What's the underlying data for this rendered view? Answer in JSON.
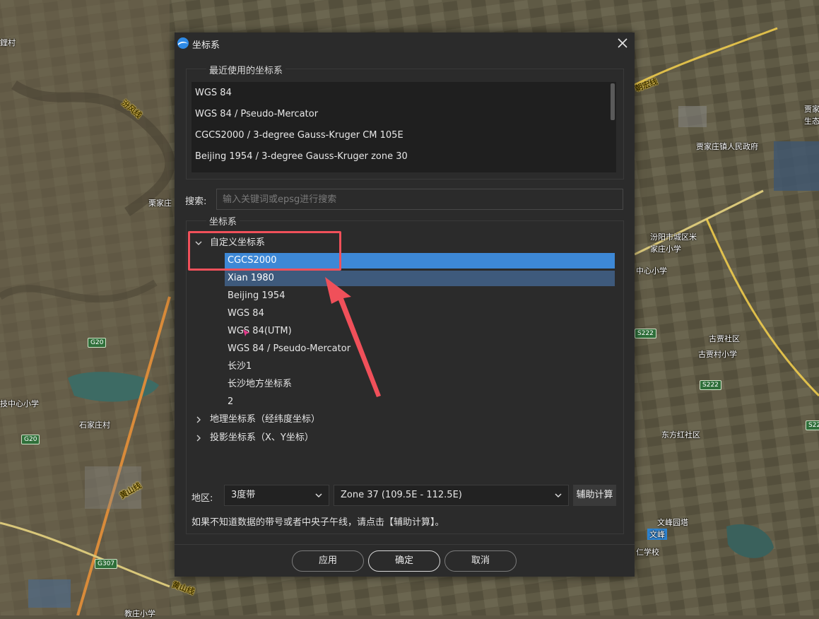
{
  "map": {
    "labels": {
      "cun_top_left": "鋰村",
      "lijiazhuang": "栗家庄",
      "jiazhuang_top_right": "贾家",
      "shengtai": "生态",
      "gov": "贾家庄镇人民政府",
      "fenyang_school_1": "汾阳市城区米",
      "fenyang_school_2": "家庄小学",
      "center_school": "中心小学",
      "gujia": "古贾社区",
      "gujia_school": "古贾村小学",
      "dongfang": "东方红社区",
      "wenfeng": "文峰",
      "wenfeng_park": "文峰园塔",
      "renxuexiao": "仁学校",
      "jizhongxin": "技中心小学",
      "shijiazhuang": "石家庄村",
      "jiaoxin": "教庄小学"
    },
    "roads": {
      "g20_a": "G20",
      "g20_b": "G20",
      "g307": "G307",
      "s222_a": "S222",
      "s222_b": "S222",
      "s222_c": "S22",
      "huangshan_a": "黄山线",
      "huangshan_b": "黄山线",
      "fengxian": "汾风线",
      "chaohong": "朝宏线"
    }
  },
  "dialog": {
    "title": "坐标系",
    "recent": {
      "title": "最近使用的坐标系",
      "items": [
        "WGS 84",
        "WGS 84 / Pseudo-Mercator",
        "CGCS2000 / 3-degree Gauss-Kruger CM 105E",
        "Beijing 1954 / 3-degree Gauss-Kruger zone 30"
      ]
    },
    "search": {
      "label": "搜索:",
      "placeholder": "输入关键词或epsg进行搜索"
    },
    "crs": {
      "title": "坐标系",
      "custom_group": "自定义坐标系",
      "custom_items": [
        "CGCS2000",
        "Xian 1980",
        "Beijing 1954",
        "WGS 84",
        "WGS 84(UTM)",
        "WGS 84 / Pseudo-Mercator",
        "长沙1",
        "长沙地方坐标系",
        "2"
      ],
      "geo_group": "地理坐标系（经纬度坐标）",
      "proj_group": "投影坐标系（X、Y坐标）"
    },
    "zone": {
      "label": "地区:",
      "band": "3度带",
      "zone": "Zone 37 (109.5E - 112.5E)",
      "calc": "辅助计算",
      "hint": "如果不知道数据的带号或者中央子午线，请点击【辅助计算】。"
    },
    "buttons": {
      "apply": "应用",
      "ok": "确定",
      "cancel": "取消"
    }
  },
  "colors": {
    "selection_primary": "#3d88d6",
    "selection_secondary": "#3e5a7c",
    "annotation_red": "#f0505a"
  },
  "icons": [
    "app-logo-icon",
    "close-icon",
    "chevron-down-icon",
    "chevron-right-icon",
    "annotation-arrow"
  ]
}
